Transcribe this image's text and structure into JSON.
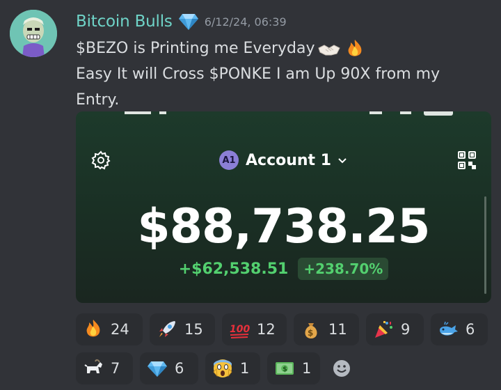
{
  "message": {
    "username": "Bitcoin Bulls",
    "timestamp": "6/12/24, 06:39",
    "badge_icon": "diamond-icon",
    "lines": [
      "$BEZO is Printing me Everyday",
      "Easy It will Cross $PONKE I am Up 90X from my",
      "Entry."
    ],
    "inline_emojis": [
      "handshake-icon",
      "fire-icon"
    ]
  },
  "wallet": {
    "account_badge": "A1",
    "account_name": "Account 1",
    "balance": "$88,738.25",
    "change_abs": "+$62,538.51",
    "change_pct": "+238.70%"
  },
  "reactions": [
    {
      "icon": "fire-icon",
      "count": "24"
    },
    {
      "icon": "rocket-icon",
      "count": "15"
    },
    {
      "icon": "hundred-icon",
      "count": "12"
    },
    {
      "icon": "money-bag-icon",
      "count": "11"
    },
    {
      "icon": "party-popper-icon",
      "count": "9"
    },
    {
      "icon": "whale-icon",
      "count": "6"
    },
    {
      "icon": "goat-icon",
      "count": "7"
    },
    {
      "icon": "diamond-icon",
      "count": "6"
    },
    {
      "icon": "scream-icon",
      "count": "1"
    },
    {
      "icon": "dollar-bill-icon",
      "count": "1"
    }
  ],
  "colors": {
    "background": "#313338",
    "username": "#6fd4c8",
    "gain_green": "#53d06f",
    "reaction_bg": "#2b2d31"
  }
}
